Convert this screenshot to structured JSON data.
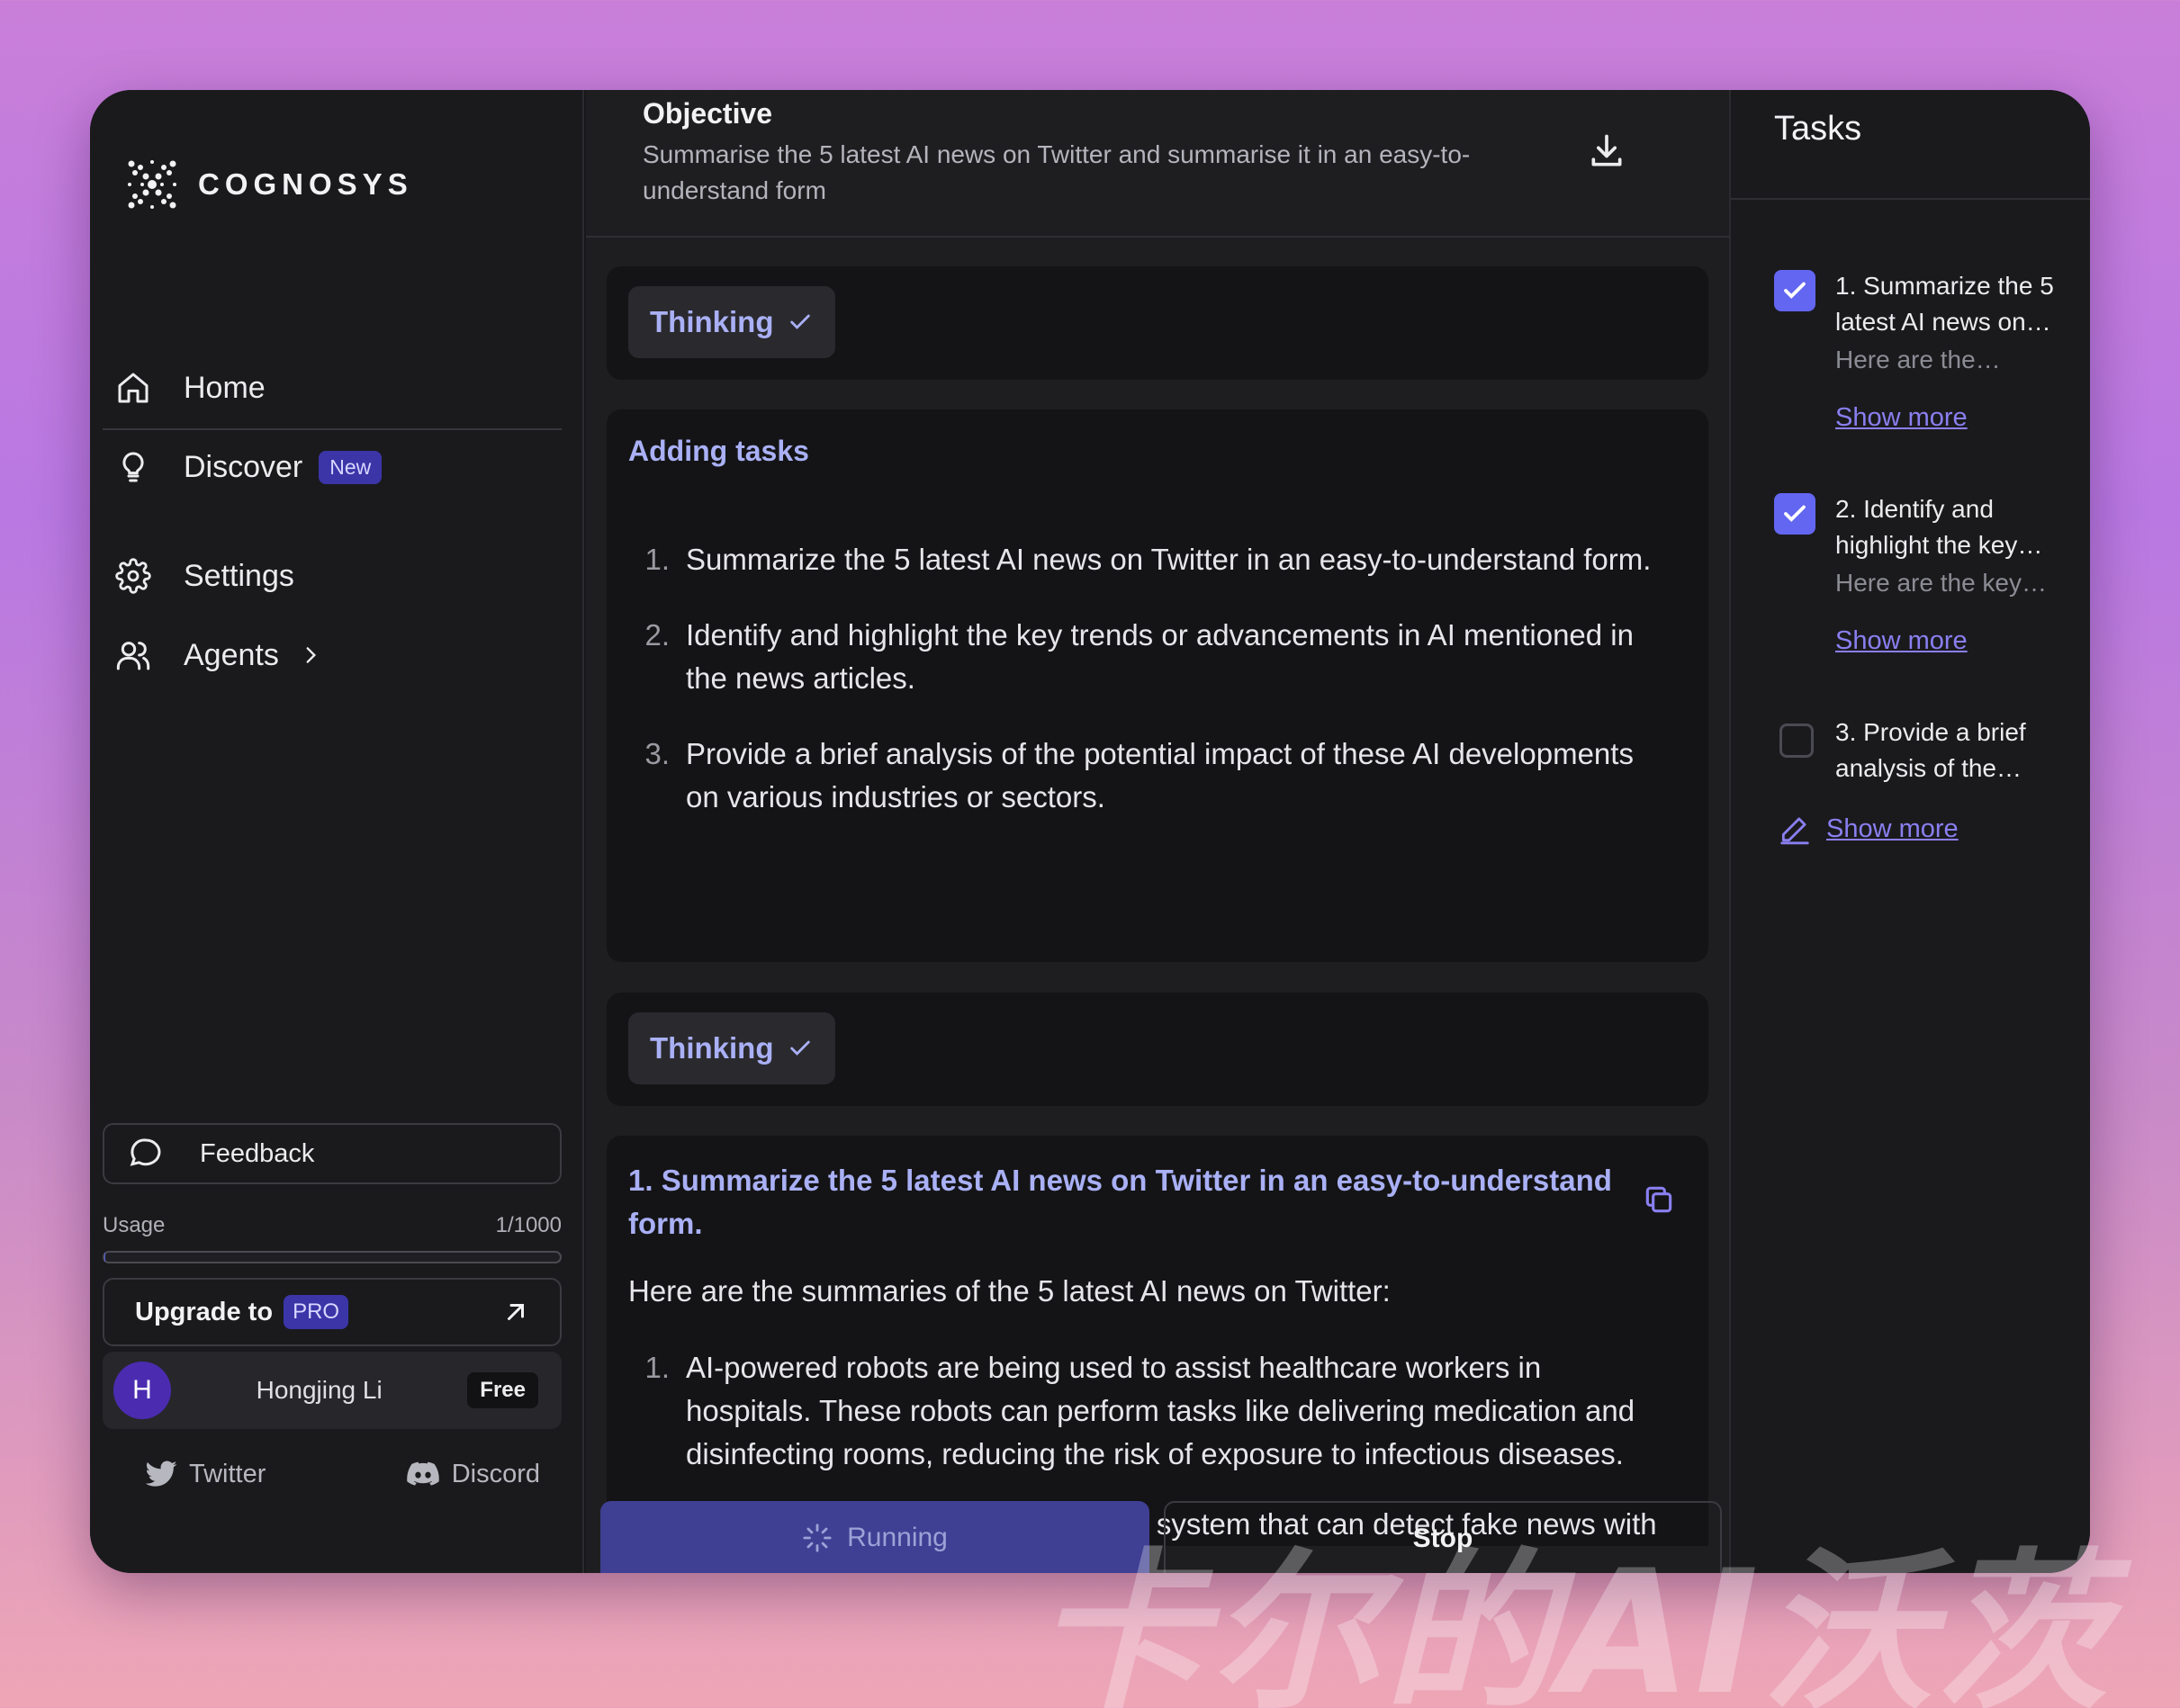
{
  "app": {
    "name": "COGNOSYS"
  },
  "sidebar": {
    "items": [
      {
        "label": "Home",
        "icon": "home-icon"
      },
      {
        "label": "Discover",
        "icon": "lightbulb-icon",
        "badge": "New"
      },
      {
        "label": "Settings",
        "icon": "gear-icon"
      },
      {
        "label": "Agents",
        "icon": "users-icon"
      }
    ],
    "feedback_label": "Feedback",
    "usage_label": "Usage",
    "usage_value": "1/1000",
    "usage_fraction": 0.001,
    "upgrade_label": "Upgrade to",
    "upgrade_badge": "PRO",
    "user": {
      "initial": "H",
      "name": "Hongjing Li",
      "plan": "Free"
    },
    "socials": [
      {
        "label": "Twitter",
        "icon": "twitter-icon"
      },
      {
        "label": "Discord",
        "icon": "discord-icon"
      }
    ]
  },
  "objective": {
    "title": "Objective",
    "text": "Summarise the 5 latest AI news on Twitter and summarise it in an easy-to-understand form"
  },
  "feed": {
    "thinking_label": "Thinking",
    "adding_tasks_title": "Adding tasks",
    "added_tasks": [
      "Summarize the 5 latest AI news on Twitter in an easy-to-understand form.",
      "Identify and highlight the key trends or advancements in AI mentioned in the news articles.",
      "Provide a brief analysis of the potential impact of these AI developments on various industries or sectors."
    ],
    "result_title": "1. Summarize the 5 latest AI news on Twitter in an easy-to-understand form.",
    "result_intro": "Here are the summaries of the 5 latest AI news on Twitter:",
    "result_items": [
      "AI-powered robots are being used to assist healthcare workers in hospitals. These robots can perform tasks like delivering medication and disinfecting rooms, reducing the risk of exposure to infectious diseases.",
      "Researchers have developed an AI system that can detect fake news with"
    ]
  },
  "controls": {
    "running_label": "Running",
    "stop_label": "Stop"
  },
  "tasks": {
    "title": "Tasks",
    "items": [
      {
        "title": "1. Summarize the 5 latest AI news on…",
        "preview": "Here are the…",
        "more": "Show more",
        "checked": true
      },
      {
        "title": "2. Identify and highlight the key…",
        "preview": "Here are the key…",
        "more": "Show more",
        "checked": true
      },
      {
        "title": "3. Provide a brief analysis of the…",
        "preview": "",
        "more": "Show more",
        "checked": false
      }
    ]
  },
  "watermark": "卡尔的AI沃茨",
  "colors": {
    "accent": "#6366f1",
    "accent_text": "#a9b0f5",
    "badge_bg": "#3b35a8",
    "running_bg": "#3f3f94"
  }
}
